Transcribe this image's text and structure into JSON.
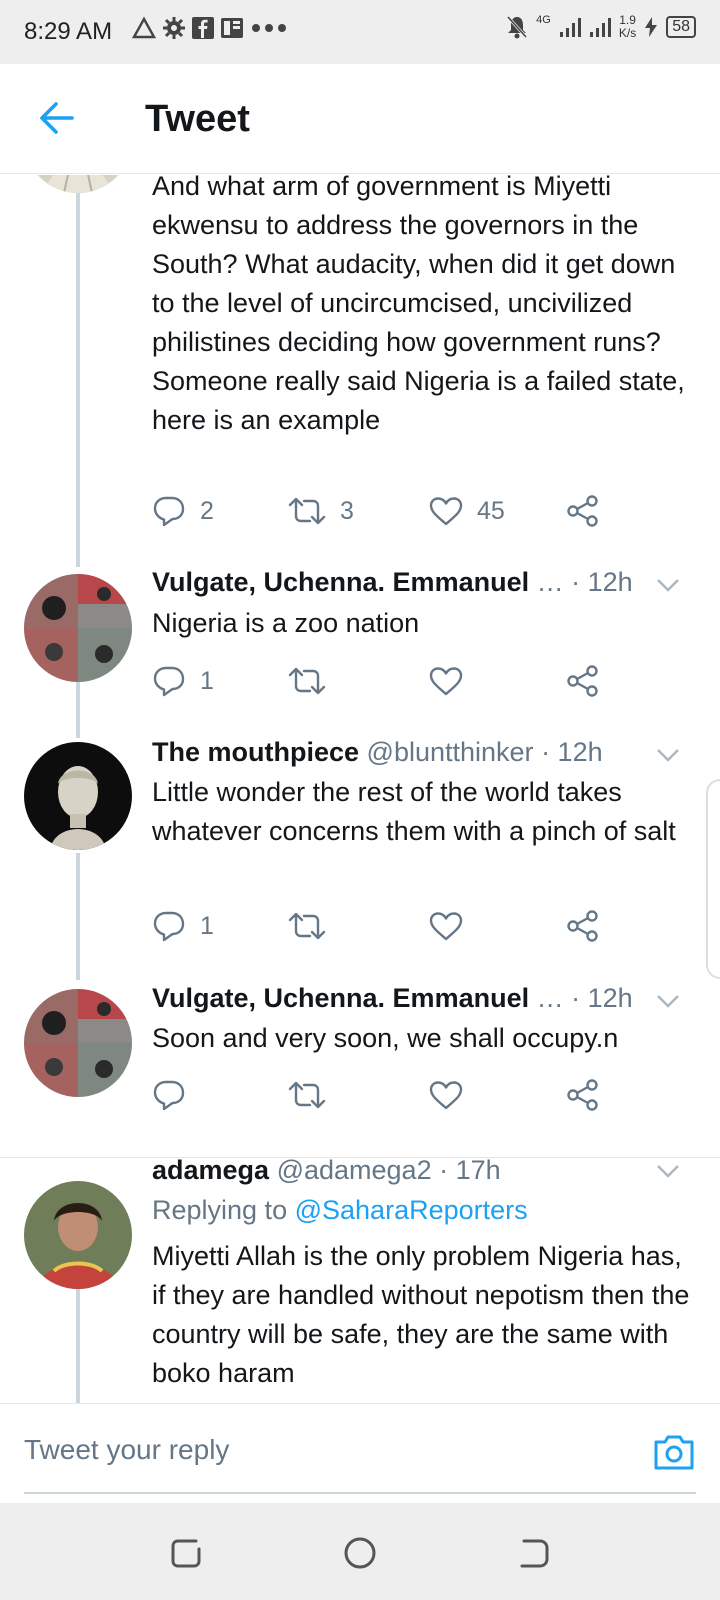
{
  "status_bar": {
    "time": "8:29 AM",
    "network": "4G",
    "speed_value": "1.9",
    "speed_unit": "K/s",
    "battery": "58"
  },
  "header": {
    "title": "Tweet"
  },
  "tweets": [
    {
      "text": "And what arm of government is Miyetti ekwensu to address the governors in the South? What audacity, when did it get down to the level of uncircumcised, uncivilized philistines deciding how government runs? Someone really said Nigeria is a failed state, here is an example",
      "replies": "2",
      "retweets": "3",
      "likes": "45"
    },
    {
      "name": "Vulgate, Uchenna. Emmanuel",
      "handle": "…",
      "time": "· 12h",
      "text": "Nigeria is a zoo nation",
      "replies": "1",
      "retweets": "",
      "likes": ""
    },
    {
      "name": "The mouthpiece",
      "handle": "@bluntthinker",
      "time": "· 12h",
      "text": "Little wonder the rest of the world takes whatever concerns them with a pinch of salt",
      "replies": "1",
      "retweets": "",
      "likes": ""
    },
    {
      "name": "Vulgate, Uchenna. Emmanuel",
      "handle": "…",
      "time": "· 12h",
      "text": "Soon and very soon, we shall occupy.n",
      "replies": "",
      "retweets": "",
      "likes": ""
    },
    {
      "name": "adamega",
      "handle": "@adamega2",
      "time": "· 17h",
      "replying_label": "Replying to",
      "replying_to": "@SaharaReporters",
      "text": "Miyetti Allah is the only problem Nigeria has, if they are handled without nepotism then the country will be safe, they are the same with boko haram"
    }
  ],
  "composer": {
    "placeholder": "Tweet your reply"
  },
  "colors": {
    "accent": "#1da1f2",
    "muted": "#657786",
    "text": "#14171a",
    "thread_line": "#ccd6dd"
  }
}
